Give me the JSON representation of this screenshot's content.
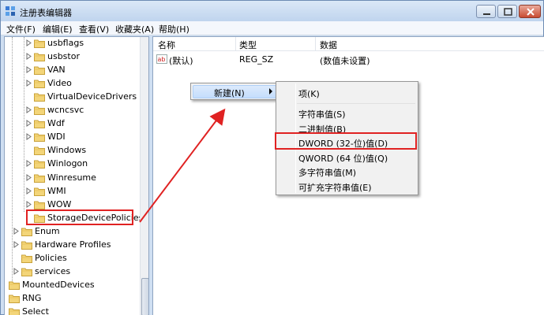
{
  "window": {
    "title": "注册表编辑器",
    "accent_color": "#bfd4ee",
    "highlight_color": "#e02222"
  },
  "menubar": [
    {
      "label": "文件(F)"
    },
    {
      "label": "编辑(E)"
    },
    {
      "label": "查看(V)"
    },
    {
      "label": "收藏夹(A)"
    },
    {
      "label": "帮助(H)"
    }
  ],
  "tree": {
    "items": [
      {
        "label": "usbflags",
        "icon": "folder-icon",
        "expandable": true
      },
      {
        "label": "usbstor",
        "icon": "folder-icon",
        "expandable": true
      },
      {
        "label": "VAN",
        "icon": "folder-icon",
        "expandable": true
      },
      {
        "label": "Video",
        "icon": "folder-icon",
        "expandable": true
      },
      {
        "label": "VirtualDeviceDrivers",
        "icon": "folder-icon",
        "expandable": false
      },
      {
        "label": "wcncsvc",
        "icon": "folder-icon",
        "expandable": true
      },
      {
        "label": "Wdf",
        "icon": "folder-icon",
        "expandable": true
      },
      {
        "label": "WDI",
        "icon": "folder-icon",
        "expandable": true
      },
      {
        "label": "Windows",
        "icon": "folder-icon",
        "expandable": false
      },
      {
        "label": "Winlogon",
        "icon": "folder-icon",
        "expandable": true
      },
      {
        "label": "Winresume",
        "icon": "folder-icon",
        "expandable": true
      },
      {
        "label": "WMI",
        "icon": "folder-icon",
        "expandable": true
      },
      {
        "label": "WOW",
        "icon": "folder-icon",
        "expandable": true
      },
      {
        "label": "StorageDevicePolicies",
        "icon": "folder-icon",
        "expandable": false,
        "selected": true
      },
      {
        "label": "Enum",
        "icon": "folder-icon",
        "expandable": true
      },
      {
        "label": "Hardware Profiles",
        "icon": "folder-icon",
        "expandable": true
      },
      {
        "label": "Policies",
        "icon": "folder-icon",
        "expandable": false
      },
      {
        "label": "services",
        "icon": "folder-icon",
        "expandable": true
      },
      {
        "label": "MountedDevices",
        "icon": "folder-icon",
        "expandable": false
      },
      {
        "label": "RNG",
        "icon": "folder-icon",
        "expandable": false
      },
      {
        "label": "Select",
        "icon": "folder-icon",
        "expandable": false
      }
    ]
  },
  "list": {
    "columns": [
      "名称",
      "类型",
      "数据"
    ],
    "rows": [
      {
        "name": "(默认)",
        "type": "REG_SZ",
        "data": "(数值未设置)",
        "icon": "string-value-icon"
      }
    ]
  },
  "context_menu": {
    "parent_label": "新建(N)",
    "items": [
      {
        "label": "项(K)"
      },
      {
        "label": "字符串值(S)"
      },
      {
        "label": "二进制值(B)"
      },
      {
        "label": "DWORD (32-位)值(D)",
        "highlighted": true
      },
      {
        "label": "QWORD (64 位)值(Q)"
      },
      {
        "label": "多字符串值(M)"
      },
      {
        "label": "可扩充字符串值(E)"
      }
    ]
  }
}
